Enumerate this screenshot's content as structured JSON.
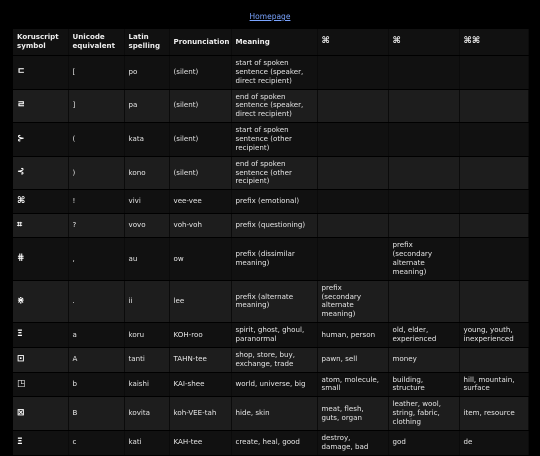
{
  "homepage_link": "Homepage",
  "columns": [
    {
      "label": "Koruscript symbol"
    },
    {
      "label": "Unicode equivalent"
    },
    {
      "label": "Latin spelling"
    },
    {
      "label": "Pronunciation"
    },
    {
      "label": "Meaning"
    },
    {
      "label": "⌘"
    },
    {
      "label": "⌘"
    },
    {
      "label": "⌘⌘"
    }
  ],
  "rows": [
    {
      "symbol": "ㄷ",
      "unicode": "[",
      "latin": "po",
      "pron": "(silent)",
      "meaning": "start of spoken sentence (speaker, direct recipient)",
      "c1": "",
      "c2": "",
      "c3": ""
    },
    {
      "symbol": "ㄹ",
      "unicode": "]",
      "latin": "pa",
      "pron": "(silent)",
      "meaning": "end of spoken sentence (speaker, direct recipient)",
      "c1": "",
      "c2": "",
      "c3": ""
    },
    {
      "symbol": "⊱",
      "unicode": "(",
      "latin": "kata",
      "pron": "(silent)",
      "meaning": "start of spoken sentence (other recipient)",
      "c1": "",
      "c2": "",
      "c3": ""
    },
    {
      "symbol": "⊰",
      "unicode": ")",
      "latin": "kono",
      "pron": "(silent)",
      "meaning": "end of spoken sentence (other recipient)",
      "c1": "",
      "c2": "",
      "c3": ""
    },
    {
      "symbol": "⌘",
      "unicode": "!",
      "latin": "vivi",
      "pron": "vee-vee",
      "meaning": "prefix (emotional)",
      "c1": "",
      "c2": "",
      "c3": ""
    },
    {
      "symbol": "⌗",
      "unicode": "?",
      "latin": "vovo",
      "pron": "voh-voh",
      "meaning": "prefix (questioning)",
      "c1": "",
      "c2": "",
      "c3": ""
    },
    {
      "symbol": "⋕",
      "unicode": ",",
      "latin": "au",
      "pron": "ow",
      "meaning": "prefix (dissimilar meaning)",
      "c1": "",
      "c2": "prefix (secondary alternate meaning)",
      "c3": ""
    },
    {
      "symbol": "⋇",
      "unicode": ".",
      "latin": "ii",
      "pron": "lee",
      "meaning": "prefix (alternate meaning)",
      "c1": "prefix (secondary alternate meaning)",
      "c2": "",
      "c3": ""
    },
    {
      "symbol": "Ξ",
      "unicode": "a",
      "latin": "koru",
      "pron": "KOH-roo",
      "meaning": "spirit, ghost, ghoul, paranormal",
      "c1": "human, person",
      "c2": "old, elder, experienced",
      "c3": "young, youth, inexperienced"
    },
    {
      "symbol": "⊡",
      "unicode": "A",
      "latin": "tanti",
      "pron": "TAHN-tee",
      "meaning": "shop, store, buy, exchange, trade",
      "c1": "pawn, sell",
      "c2": "money",
      "c3": ""
    },
    {
      "symbol": "◳",
      "unicode": "b",
      "latin": "kaishi",
      "pron": "KAI-shee",
      "meaning": "world, universe, big",
      "c1": "atom, molecule, small",
      "c2": "building, structure",
      "c3": "hill, mountain, surface"
    },
    {
      "symbol": "⊠",
      "unicode": "B",
      "latin": "kovita",
      "pron": "koh-VEE-tah",
      "meaning": "hide, skin",
      "c1": "meat, flesh, guts, organ",
      "c2": "leather, wool, string, fabric, clothing",
      "c3": "item, resource"
    },
    {
      "symbol": "Ξ",
      "unicode": "c",
      "latin": "kati",
      "pron": "KAH-tee",
      "meaning": "create, heal, good",
      "c1": "destroy, damage, bad",
      "c2": "god",
      "c3": "de"
    }
  ]
}
